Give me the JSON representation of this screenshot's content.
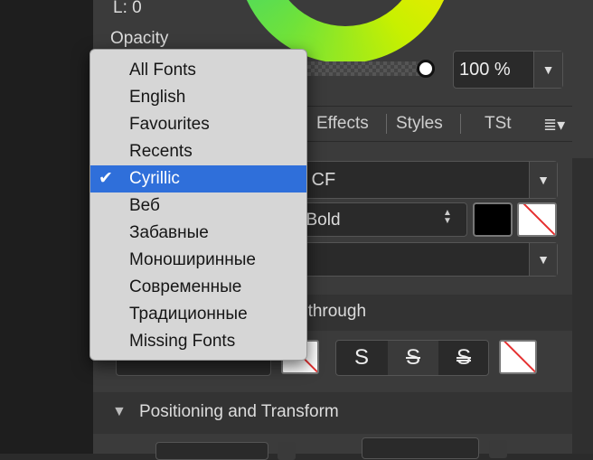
{
  "color_readout": "L: 0",
  "opacity": {
    "label": "Opacity",
    "value": "100 %",
    "level": 1.0
  },
  "tabs": {
    "effects": "Effects",
    "styles": "Styles",
    "tst": "TSt"
  },
  "font": {
    "family_partial": "y CF",
    "style_partial": "i Bold"
  },
  "strikethrough_partial": "ethrough",
  "strike_buttons": [
    "S",
    "S",
    "S"
  ],
  "positioning_section": "Positioning and Transform",
  "icons": {
    "dropdown": "chevron-down-icon",
    "menu": "panel-menu-icon",
    "check": "checkmark-icon",
    "disclosure": "disclosure-triangle-icon"
  },
  "font_menu": {
    "items": [
      {
        "label": "All Fonts",
        "selected": false
      },
      {
        "label": "English",
        "selected": false
      },
      {
        "label": "Favourites",
        "selected": false
      },
      {
        "label": "Recents",
        "selected": false
      },
      {
        "label": "Cyrillic",
        "selected": true
      },
      {
        "label": "Веб",
        "selected": false
      },
      {
        "label": "Забавные",
        "selected": false
      },
      {
        "label": "Моноширинные",
        "selected": false
      },
      {
        "label": "Современные",
        "selected": false
      },
      {
        "label": "Традиционные",
        "selected": false
      },
      {
        "label": "Missing Fonts",
        "selected": false
      }
    ]
  },
  "colors": {
    "accent": "#2f6fda",
    "panel": "#3b3b3b",
    "menu_bg": "#d6d6d6"
  }
}
